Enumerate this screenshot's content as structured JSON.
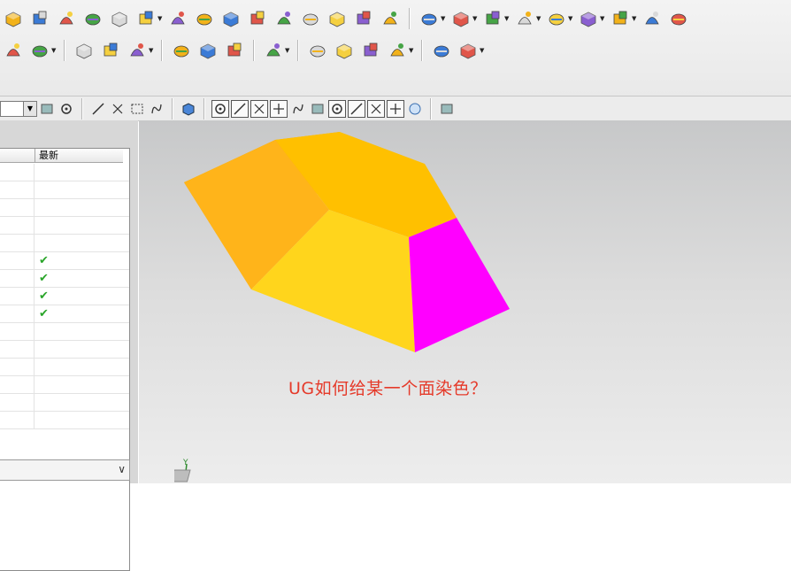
{
  "toolbar": {
    "row1_icons": [
      "block-icon",
      "emboss-icon",
      "pad-icon",
      "pattern-icon",
      "boolean-icon",
      "feature-icon",
      "box-icon",
      "sweep-icon",
      "flange-icon",
      "thicken-icon",
      "shell-icon",
      "part-icon",
      "face-blend-icon",
      "blend-icon",
      "surface-icon",
      "more-icon",
      "edit-feature-icon",
      "delete-feature-icon",
      "suppress-icon",
      "move-feature-icon",
      "replace-icon",
      "reorder-icon",
      "draft-icon",
      "offset-icon"
    ],
    "row2_icons": [
      "assembly-icon",
      "text-icon",
      "curve-icon",
      "surface-edit-icon",
      "view-section-icon",
      "cylinder-icon",
      "spring-icon",
      "bearing-icon",
      "tool-icon",
      "triangle-icon",
      "table-icon",
      "measure-icon",
      "analysis-icon",
      "part-list-icon",
      "component-icon"
    ]
  },
  "band": {
    "icons": [
      "filter-icon",
      "select-icon",
      "snap-icon",
      "point-icon",
      "rectangle-select-icon",
      "render-icon",
      "solid-icon",
      "snap-point-icon",
      "move-icon",
      "line-icon",
      "diagonal-icon",
      "curve-point-icon",
      "intersection-icon",
      "circle-center-icon",
      "circle-icon",
      "cross-icon",
      "slash-icon",
      "quadrant-icon",
      "grid-icon"
    ]
  },
  "navigator": {
    "columns": [
      "",
      "最新"
    ],
    "rows": [
      {
        "check": ""
      },
      {
        "check": ""
      },
      {
        "check": ""
      },
      {
        "check": ""
      },
      {
        "check": ""
      },
      {
        "check": "✔"
      },
      {
        "check": "✔"
      },
      {
        "check": "✔"
      },
      {
        "check": "✔"
      },
      {
        "check": ""
      },
      {
        "check": ""
      },
      {
        "check": ""
      },
      {
        "check": ""
      },
      {
        "check": ""
      },
      {
        "check": ""
      }
    ],
    "bottom_chevron": "∨"
  },
  "viewport": {
    "caption": "UG如何给某一个面染色？",
    "colors": {
      "top_face_dark": "#ffa800",
      "top_face": "#ffc000",
      "left_face": "#ffb41a",
      "front_face": "#ffd51c",
      "highlighted_face": "#ff00ff"
    },
    "triad_label": "Y"
  }
}
